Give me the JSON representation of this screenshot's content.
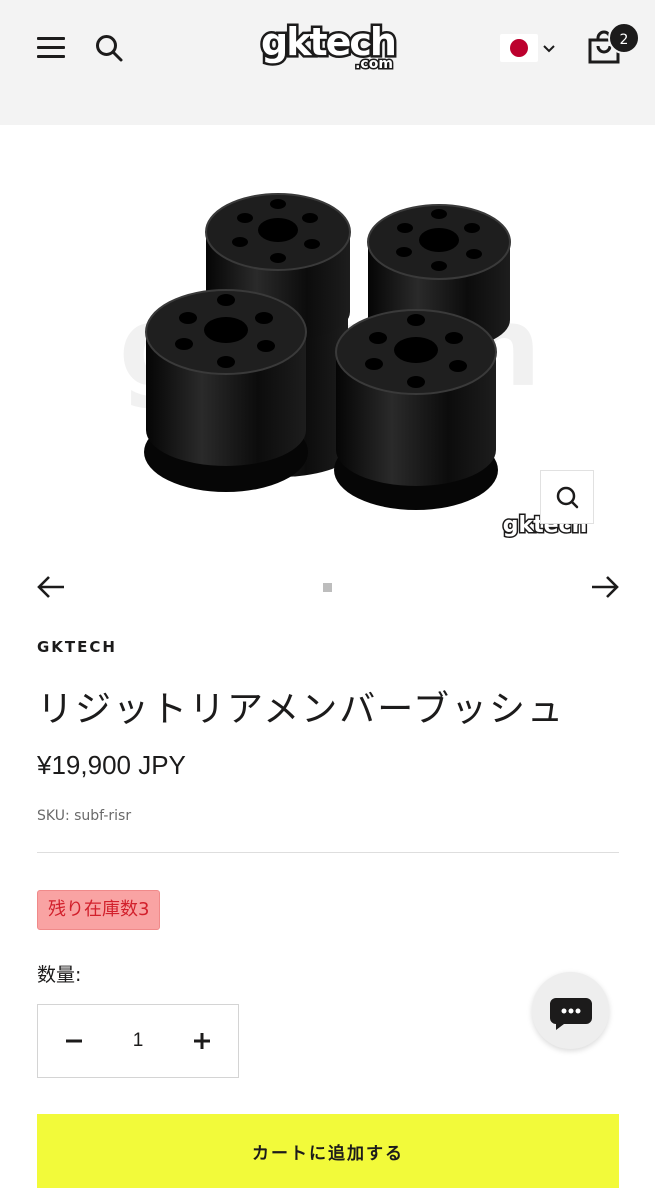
{
  "header": {
    "logo_text": "gktech",
    "logo_sub": ".com",
    "cart_count": "2",
    "country_flag": "japan-flag-icon"
  },
  "product": {
    "vendor": "GKTECH",
    "title": "リジットリアメンバーブッシュ",
    "price": "¥19,900 JPY",
    "sku": "SKU: subf-risr",
    "stock_badge": "残り在庫数3",
    "quantity_label": "数量:",
    "quantity_value": "1",
    "add_to_cart": "カートに追加する",
    "image_watermark": "gktech"
  },
  "colors": {
    "accent": "#f2fa3a",
    "stock_bg": "#f9a3a3",
    "header_bg": "#f3f3f3"
  }
}
